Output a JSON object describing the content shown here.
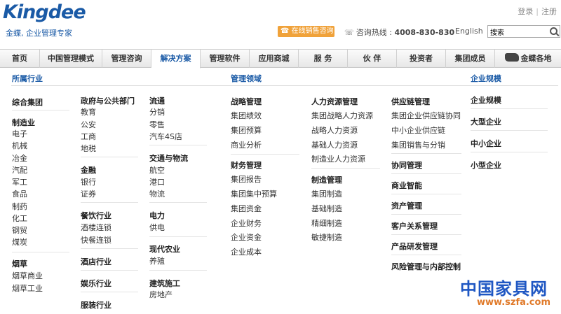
{
  "header": {
    "logo": "Kingdee",
    "tagline": "金蝶, 企业管理专家",
    "login": "登录",
    "divider": "|",
    "register": "注册",
    "online_sales": "在线销售咨询",
    "hotline_label": "咨询热线 :",
    "hotline_number": "4008-830-830",
    "english": "English",
    "search_value": "搜索"
  },
  "nav": [
    "首页",
    "中国管理模式",
    "管理咨询",
    "解决方案",
    "管理软件",
    "应用商城",
    "服 务",
    "伙 伴",
    "投资者",
    "集团成员",
    "金蝶各地"
  ],
  "dropdown": {
    "col1_head": "所属行业",
    "col2_head": "管理领域",
    "col3_head": "企业规模",
    "industry": {
      "zonghe": "综合集团",
      "zhizao": "制造业",
      "zhizao_items": [
        "电子",
        "机械",
        "冶金",
        "汽配",
        "军工",
        "食品",
        "制药",
        "化工",
        "钢贸",
        "煤炭"
      ],
      "yancao": "烟草",
      "yancao_items": [
        "烟草商业",
        "烟草工业"
      ],
      "zhengfu": "政府与公共部门",
      "zhengfu_items": [
        "教育",
        "公安",
        "工商",
        "地税"
      ],
      "jinrong": "金融",
      "jinrong_items": [
        "银行",
        "证券"
      ],
      "canyin": "餐饮行业",
      "canyin_items": [
        "酒楼连锁",
        "快餐连锁"
      ],
      "jiudian": "酒店行业",
      "yule": "娱乐行业",
      "fuzhuang": "服装行业",
      "liutong": "流通",
      "liutong_items": [
        "分销",
        "零售",
        "汽车4S店"
      ],
      "jiaotong": "交通与物流",
      "jiaotong_items": [
        "航空",
        "港口",
        "物流"
      ],
      "dianli": "电力",
      "dianli_items": [
        "供电"
      ],
      "nongye": "现代农业",
      "nongye_items": [
        "养殖"
      ],
      "jianzhu": "建筑施工",
      "jianzhu_items": [
        "房地产"
      ]
    },
    "domain": {
      "zhanlue": "战略管理",
      "zhanlue_items": [
        "集团绩效",
        "集团预算",
        "商业分析"
      ],
      "caiwu": "财务管理",
      "caiwu_items": [
        "集团报告",
        "集团集中预算",
        "集团资金",
        "企业财务",
        "企业资金",
        "企业成本"
      ],
      "renli": "人力资源管理",
      "renli_items": [
        "集团战略人力资源",
        "战略人力资源",
        "基础人力资源",
        "制造业人力资源"
      ],
      "zhizao": "制造管理",
      "zhizao_items": [
        "集团制造",
        "基础制造",
        "精细制造",
        "敏捷制造"
      ],
      "gongying": "供应链管理",
      "gongying_items": [
        "集团企业供应链协同",
        "中小企业供应链",
        "集团销售与分销"
      ],
      "xietong": "协同管理",
      "shangye": "商业智能",
      "zichan": "资产管理",
      "kehu": "客户关系管理",
      "chanpin": "产品研发管理",
      "fengxian": "风险管理与内部控制"
    },
    "scale": [
      "企业规模",
      "大型企业",
      "中小企业",
      "小型企业"
    ]
  },
  "watermark": {
    "cn": "中国家具网",
    "url": "www.szfa.com"
  }
}
